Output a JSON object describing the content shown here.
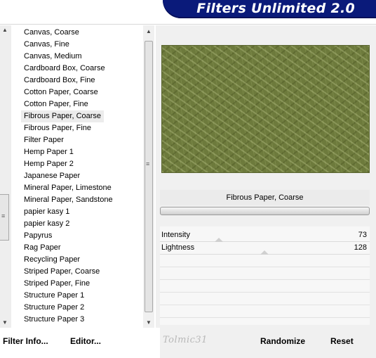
{
  "window": {
    "title": "Filters Unlimited 2.0"
  },
  "filter_list": {
    "items": [
      "Canvas, Coarse",
      "Canvas, Fine",
      "Canvas, Medium",
      "Cardboard Box, Coarse",
      "Cardboard Box, Fine",
      "Cotton Paper, Coarse",
      "Cotton Paper, Fine",
      "Fibrous Paper, Coarse",
      "Fibrous Paper, Fine",
      "Filter Paper",
      "Hemp Paper 1",
      "Hemp Paper 2",
      "Japanese Paper",
      "Mineral Paper, Limestone",
      "Mineral Paper, Sandstone",
      "papier kasy 1",
      "papier kasy 2",
      "Papyrus",
      "Rag Paper",
      "Recycling Paper",
      "Striped Paper, Coarse",
      "Striped Paper, Fine",
      "Structure Paper 1",
      "Structure Paper 2",
      "Structure Paper 3"
    ],
    "selected": "Fibrous Paper, Coarse"
  },
  "preview": {
    "filter_name": "Fibrous Paper, Coarse",
    "texture_color": "#6d7a3c"
  },
  "parameters": [
    {
      "label": "Intensity",
      "value": "73"
    },
    {
      "label": "Lightness",
      "value": "128"
    }
  ],
  "buttons": {
    "filter_info": "Filter Info...",
    "editor": "Editor...",
    "randomize": "Randomize",
    "reset": "Reset"
  },
  "signature": "Tolmic31"
}
